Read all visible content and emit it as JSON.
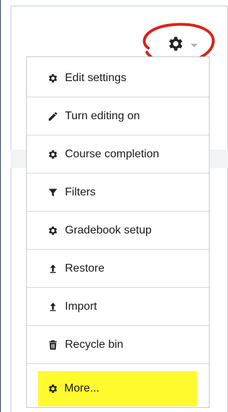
{
  "actions_menu": {
    "toggle_icon": "gear-icon",
    "items": [
      {
        "label": "Edit settings",
        "icon": "gear-icon"
      },
      {
        "label": "Turn editing on",
        "icon": "pencil-icon"
      },
      {
        "label": "Course completion",
        "icon": "gear-icon"
      },
      {
        "label": "Filters",
        "icon": "filter-icon"
      },
      {
        "label": "Gradebook setup",
        "icon": "gear-icon"
      },
      {
        "label": "Restore",
        "icon": "upload-arrow-icon"
      },
      {
        "label": "Import",
        "icon": "upload-arrow-icon"
      },
      {
        "label": "Recycle bin",
        "icon": "trash-icon"
      },
      {
        "label": "More...",
        "icon": "gear-icon",
        "highlighted": true
      }
    ]
  },
  "colors": {
    "highlight": "#fffb2f",
    "annotation": "#d9231b",
    "text": "#1a1a1a"
  }
}
